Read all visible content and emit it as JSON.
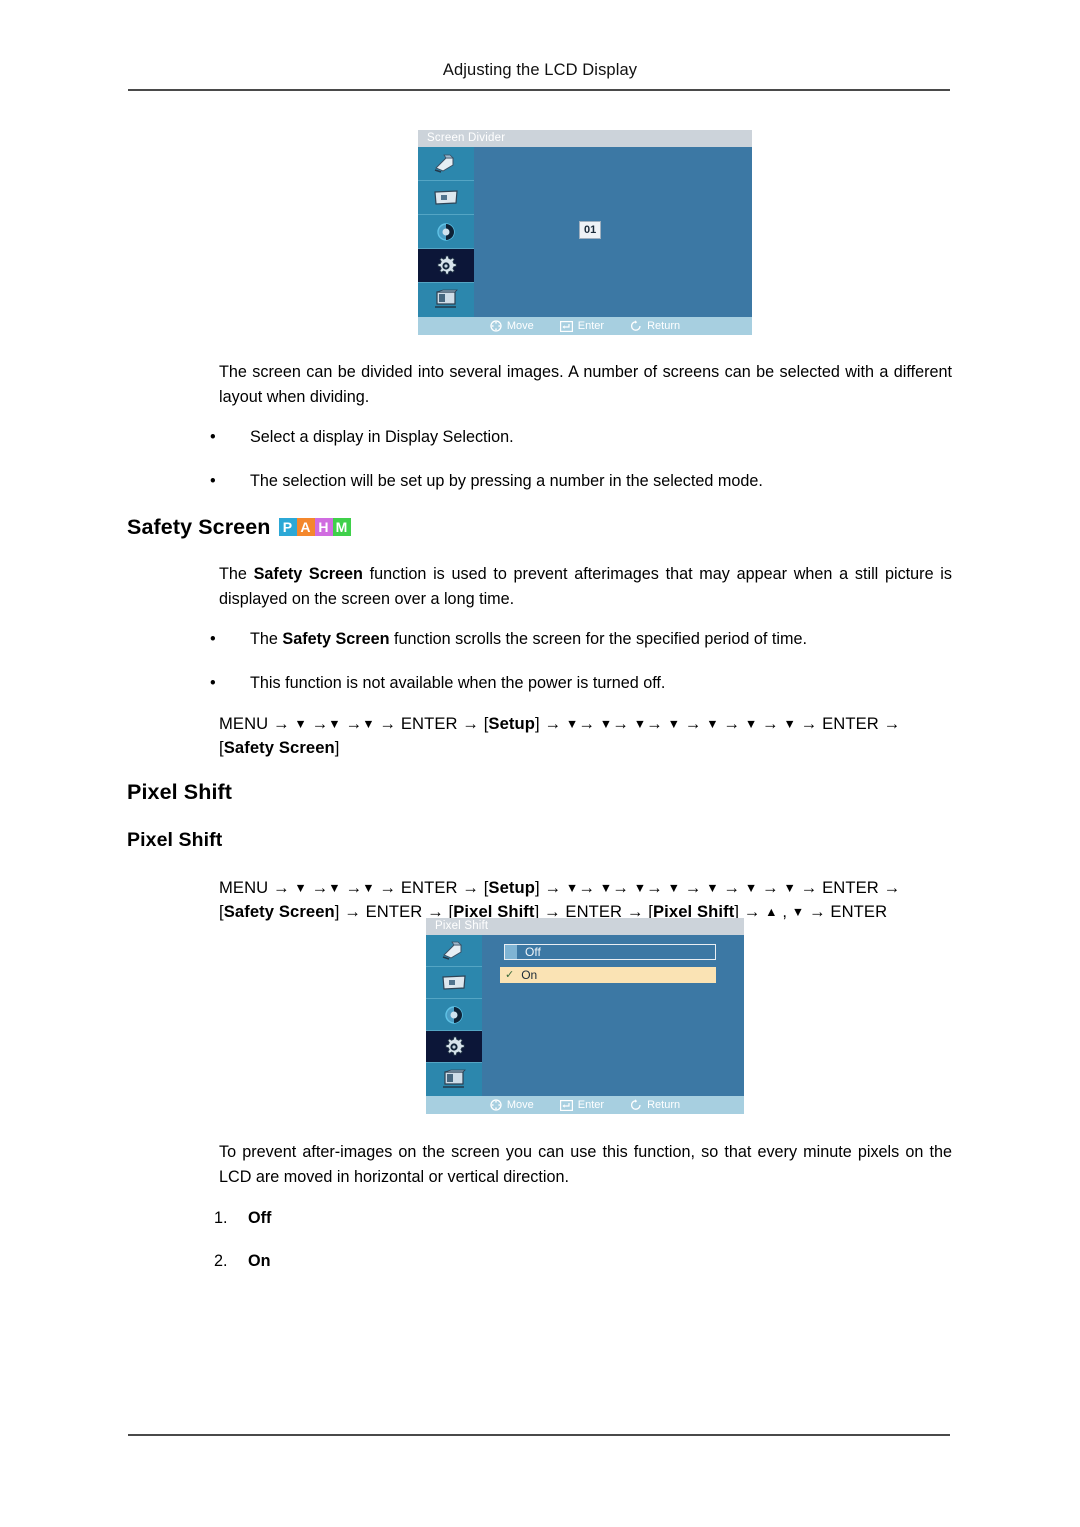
{
  "header": {
    "title": "Adjusting the LCD Display"
  },
  "osd_screen_divider": {
    "title": "Screen Divider",
    "badge": "01",
    "sidebar_icons": [
      "picture-icon",
      "screen-adjust-icon",
      "color-contrast-icon",
      "setup-gear-icon",
      "multi-control-icon"
    ],
    "footer": {
      "move": "Move",
      "enter": "Enter",
      "return": "Return"
    }
  },
  "screen_divider_text": {
    "paragraph": "The screen can be divided into several images. A number of screens can be selected with a different layout when dividing.",
    "bullets": [
      "Select a display in Display Selection.",
      "The selection will be set up by pressing a number in the selected mode."
    ]
  },
  "safety_screen": {
    "heading": "Safety Screen",
    "badges": [
      {
        "letter": "P",
        "color": "#2ca8d6"
      },
      {
        "letter": "A",
        "color": "#f4872c"
      },
      {
        "letter": "H",
        "color": "#d06ce0"
      },
      {
        "letter": "M",
        "color": "#3fd04a"
      }
    ],
    "paragraph_prefix": "The ",
    "paragraph_bold": "Safety Screen",
    "paragraph_suffix": " function is used to prevent afterimages that may appear when a still picture is displayed on the screen over a long time.",
    "bullet1_prefix": "The ",
    "bullet1_bold": "Safety Screen",
    "bullet1_suffix": " function scrolls the screen for the specified period of time.",
    "bullet2": "This function is not available when the power is turned off.",
    "menu_path": {
      "line1_start": "MENU → ",
      "tri": "▼",
      "enter": "ENTER",
      "setup": "Setup",
      "safety_screen": "Safety Screen"
    }
  },
  "pixel_shift": {
    "heading_major": "Pixel Shift",
    "heading_minor": "Pixel Shift",
    "menu_path": {
      "enter": "ENTER",
      "setup": "Setup",
      "safety_screen": "Safety Screen",
      "pixel_shift": "Pixel Shift",
      "up_tri": "▲",
      "down_tri": "▼"
    },
    "osd": {
      "title": "Pixel Shift",
      "options": [
        {
          "label": "Off",
          "selected": false
        },
        {
          "label": "On",
          "selected": true
        }
      ],
      "footer": {
        "move": "Move",
        "enter": "Enter",
        "return": "Return"
      }
    },
    "paragraph": "To prevent after-images on the screen you can use this function, so that every minute pixels on the LCD are moved in horizontal or vertical direction.",
    "numbered": [
      {
        "num": "1.",
        "label": "Off"
      },
      {
        "num": "2.",
        "label": "On"
      }
    ]
  },
  "bullet_glyph": "•",
  "arrow_glyph": "→"
}
